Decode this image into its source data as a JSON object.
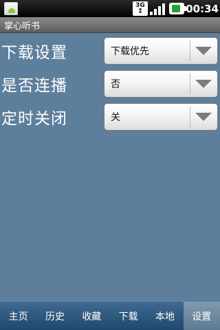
{
  "status_bar": {
    "network_label": "3G",
    "time": "00:34"
  },
  "title": "掌心听书",
  "settings": [
    {
      "label": "下载设置",
      "value": "下载优先"
    },
    {
      "label": "是否连播",
      "value": "否"
    },
    {
      "label": "定时关闭",
      "value": "关"
    }
  ],
  "tabs": [
    {
      "label": "主页",
      "active": false
    },
    {
      "label": "历史",
      "active": false
    },
    {
      "label": "收藏",
      "active": false
    },
    {
      "label": "下载",
      "active": false
    },
    {
      "label": "本地",
      "active": false
    },
    {
      "label": "设置",
      "active": true
    }
  ],
  "icons": {
    "notification": "app-notification-icon",
    "network": "network-3g-icon",
    "signal": "signal-strength-icon",
    "battery": "battery-icon",
    "dropdown": "chevron-down-icon"
  }
}
